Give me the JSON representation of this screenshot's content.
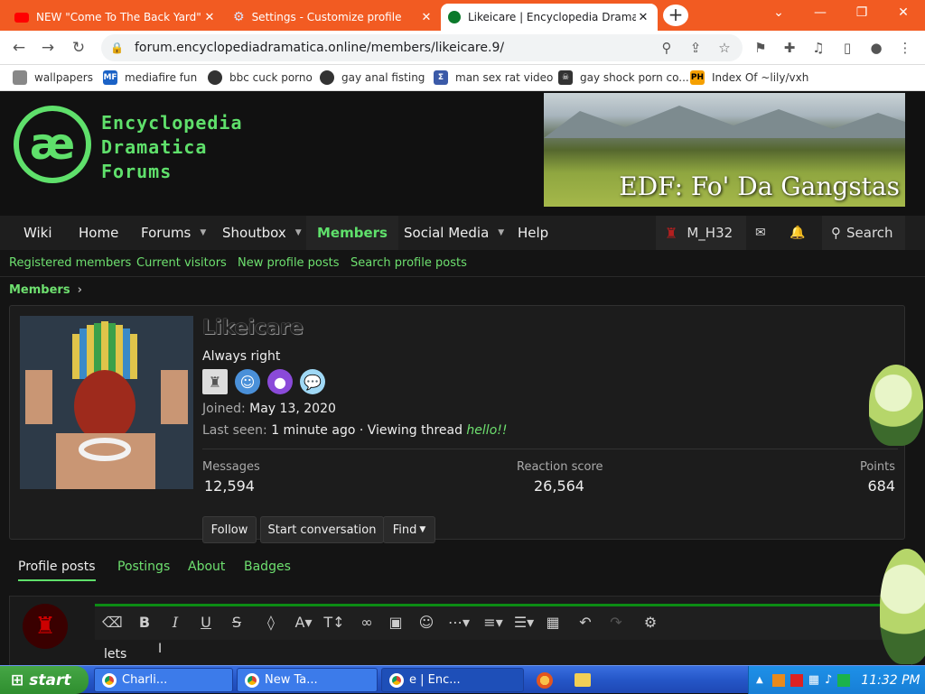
{
  "browser": {
    "tabs": [
      {
        "title": "NEW \"Come To The Back Yard\"",
        "icon": "youtube-icon",
        "color": "#ff0000"
      },
      {
        "title": "Settings - Customize profile",
        "icon": "gear-icon",
        "color": "#1a73e8"
      },
      {
        "title": "Likeicare | Encyclopedia Dramatica",
        "icon": "ed-logo-icon",
        "color": "#0b7a2b"
      }
    ],
    "url": "forum.encyclopediadramatica.online/members/likeicare.9/",
    "bookmarks": [
      {
        "label": "wallpapers",
        "badge": "",
        "color": "#555"
      },
      {
        "label": "mediafire fun",
        "badge": "MF",
        "color": "#1b62c6"
      },
      {
        "label": "bbc cuck porno",
        "badge": "",
        "color": "#333"
      },
      {
        "label": "gay anal fisting",
        "badge": "",
        "color": "#333"
      },
      {
        "label": "man sex rat video",
        "badge": "",
        "color": "#3b5aa8"
      },
      {
        "label": "gay shock porn co...",
        "badge": "",
        "color": "#333"
      },
      {
        "label": "Index Of ~lily/vxh",
        "badge": "PH",
        "color": "#f5a000"
      }
    ]
  },
  "header": {
    "logo_lines": [
      "Encyclopedia",
      "Dramatica",
      "Forums"
    ],
    "banner_caption": "EDF: Fo' Da Gangstas"
  },
  "nav": {
    "items": [
      "Wiki",
      "Home",
      "Forums",
      "Shoutbox",
      "Members",
      "Social Media",
      "Help"
    ],
    "user": "M_H32",
    "search": "Search"
  },
  "subnav": [
    "Registered members",
    "Current visitors",
    "New profile posts",
    "Search profile posts"
  ],
  "breadcrumb": "Members",
  "profile": {
    "username": "Likeicare",
    "title": "Always right",
    "joined_label": "Joined:",
    "joined": "May 13, 2020",
    "last_seen_label": "Last seen:",
    "last_seen": "1 minute ago · Viewing thread",
    "last_seen_link": "hello!!",
    "stats": [
      {
        "label": "Messages",
        "value": "12,594"
      },
      {
        "label": "Reaction score",
        "value": "26,564"
      },
      {
        "label": "Points",
        "value": "684"
      }
    ],
    "buttons": {
      "follow": "Follow",
      "conversation": "Start conversation",
      "find": "Find"
    }
  },
  "profile_tabs": [
    "Profile posts",
    "Postings",
    "About",
    "Badges"
  ],
  "editor": {
    "text": "lets"
  },
  "taskbar": {
    "start": "start",
    "items": [
      "Charli...",
      "New Ta...",
      "e | Enc..."
    ],
    "clock": "11:32 PM"
  },
  "colors": {
    "accent": "#5fe06b",
    "chrome_tab": "#f25b22",
    "taskbar": "#2557c8"
  }
}
